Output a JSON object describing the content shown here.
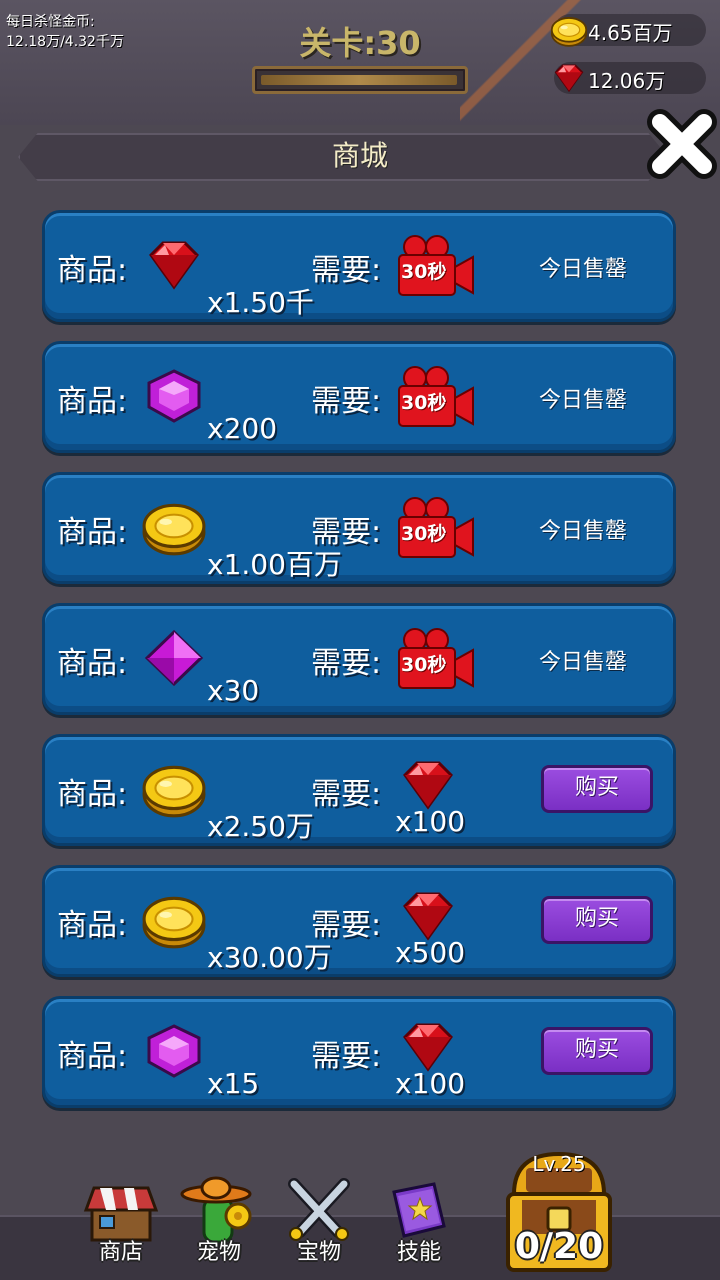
{
  "header": {
    "daily_gold_label": "每日杀怪金币:",
    "daily_gold_value": "12.18万/4.32千万",
    "level_title": "关卡:30",
    "gold_amount": "4.65百万",
    "gem_amount": "12.06万"
  },
  "panel": {
    "title": "商城"
  },
  "labels": {
    "product": "商品:",
    "need": "需要:",
    "video_time": "30秒",
    "sold_out": "今日售罄",
    "buy": "购买"
  },
  "items": [
    {
      "product_icon": "red-gem-icon",
      "product_qty": "x1.50千",
      "cost_type": "video",
      "status": "sold_out"
    },
    {
      "product_icon": "purple-hex-gem-icon",
      "product_qty": "x200",
      "cost_type": "video",
      "status": "sold_out"
    },
    {
      "product_icon": "gold-coin-icon",
      "product_qty": "x1.00百万",
      "cost_type": "video",
      "status": "sold_out"
    },
    {
      "product_icon": "pink-diamond-icon",
      "product_qty": "x30",
      "cost_type": "video",
      "status": "sold_out"
    },
    {
      "product_icon": "gold-coin-icon",
      "product_qty": "x2.50万",
      "cost_type": "red-gem",
      "cost_qty": "x100",
      "status": "buy"
    },
    {
      "product_icon": "gold-coin-icon",
      "product_qty": "x30.00万",
      "cost_type": "red-gem",
      "cost_qty": "x500",
      "status": "buy"
    },
    {
      "product_icon": "purple-hex-gem-icon",
      "product_qty": "x15",
      "cost_type": "red-gem",
      "cost_qty": "x100",
      "status": "buy"
    }
  ],
  "bottom_nav": {
    "shop": "商店",
    "pet": "宠物",
    "treasure": "宝物",
    "skill": "技能"
  },
  "chest": {
    "level": "Lv.25",
    "count": "0/20"
  },
  "colors": {
    "item_bg": "#0f5e9e",
    "buy_button": "#8a3fd4",
    "video_red": "#e0141e",
    "gold": "#f2c21a"
  }
}
